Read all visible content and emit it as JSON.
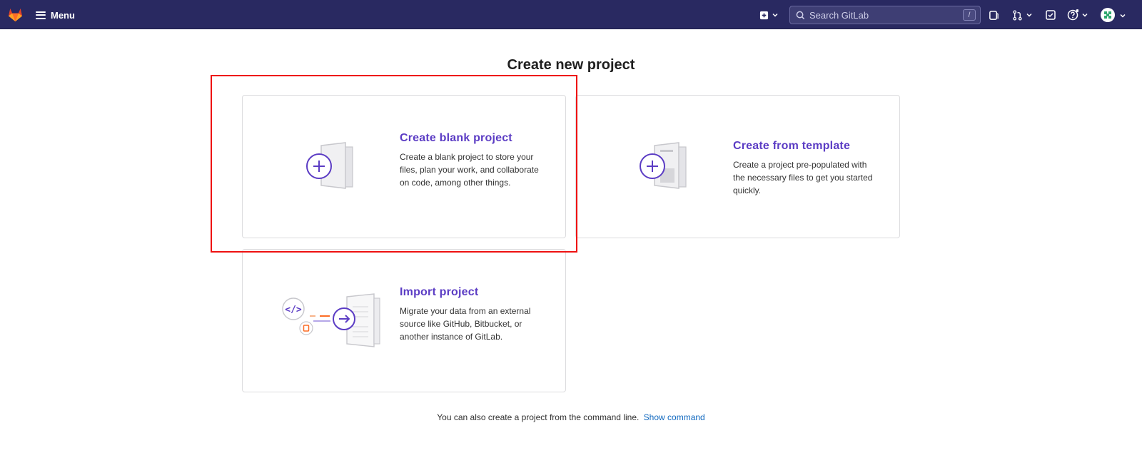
{
  "navbar": {
    "menu_label": "Menu",
    "search_placeholder": "Search GitLab",
    "search_shortcut": "/",
    "icons": [
      "gitlab-logo-icon",
      "hamburger-icon",
      "new-item-icon",
      "chevron-down-icon",
      "search-icon",
      "issues-icon",
      "merge-requests-icon",
      "todos-icon",
      "help-icon",
      "avatar-icon"
    ]
  },
  "page": {
    "title": "Create new project"
  },
  "cards": {
    "blank": {
      "title": "Create blank project",
      "description": "Create a blank project to store your files, plan your work, and collaborate on code, among other things."
    },
    "template": {
      "title": "Create from template",
      "description": "Create a project pre-populated with the necessary files to get you started quickly."
    },
    "import": {
      "title": "Import project",
      "description": "Migrate your data from an external source like GitHub, Bitbucket, or another instance of GitLab."
    }
  },
  "footer": {
    "text": "You can also create a project from the command line.",
    "link": "Show command"
  },
  "colors": {
    "navbar": "#292961",
    "accent_purple": "#5b3cc4",
    "link_blue": "#1068bf",
    "highlight_red": "#ee1111"
  }
}
